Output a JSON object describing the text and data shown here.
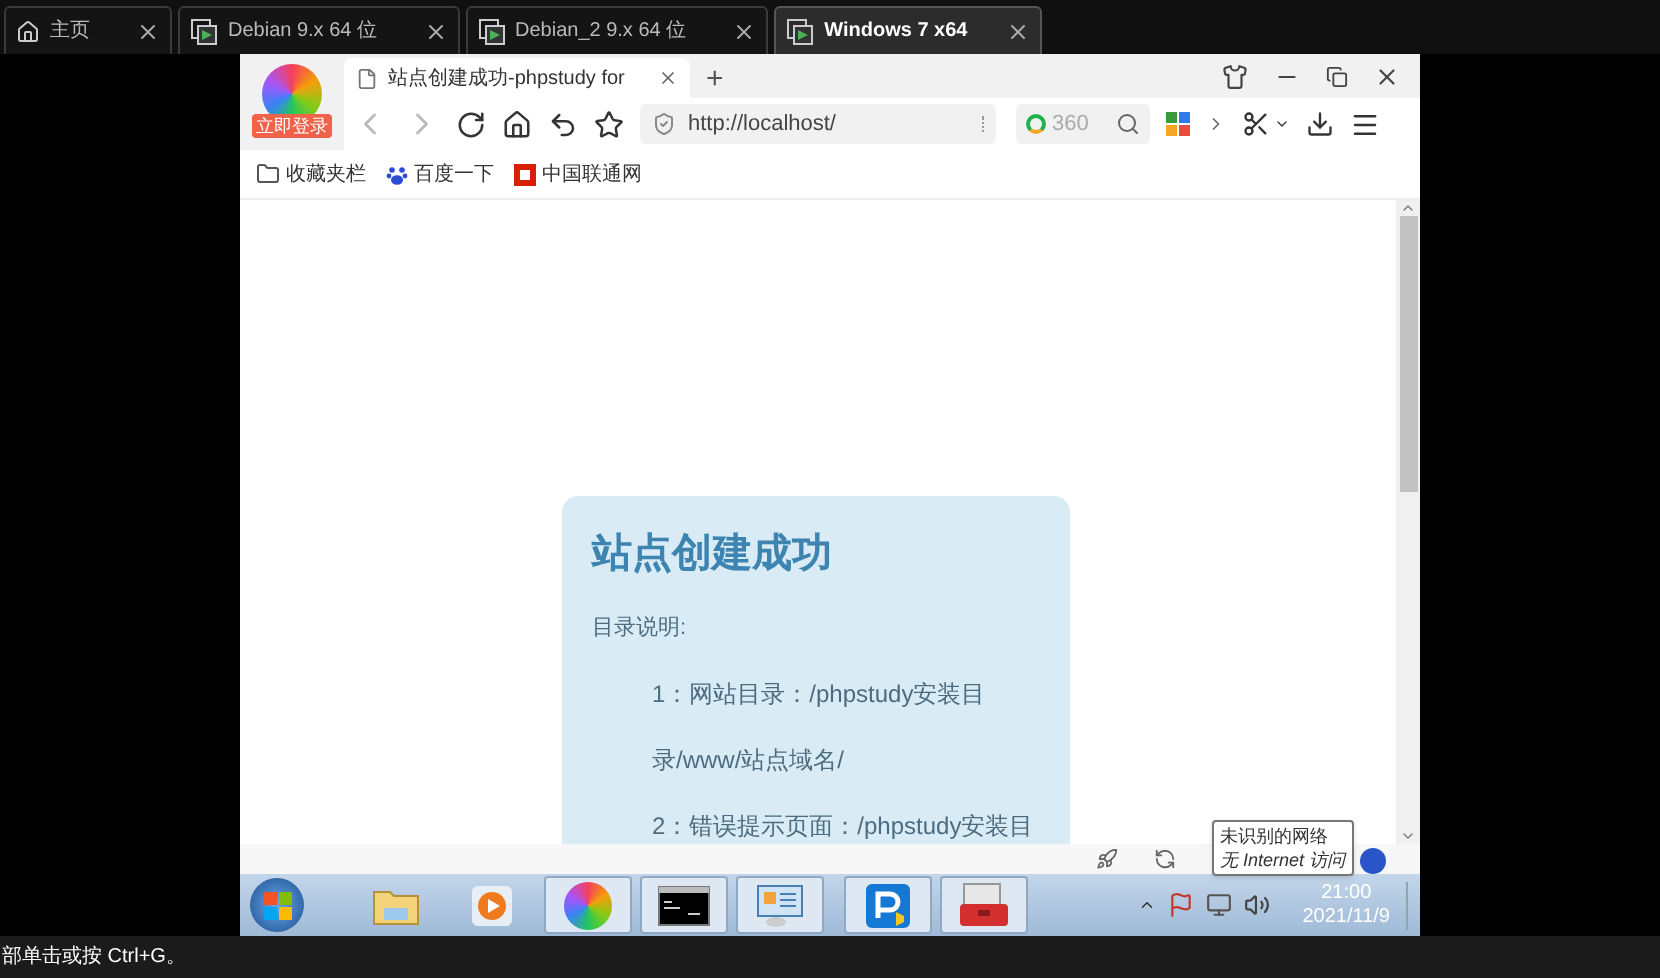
{
  "vm_tabs": [
    {
      "kind": "home",
      "label": "主页",
      "selected": false
    },
    {
      "kind": "vm",
      "label": "Debian 9.x 64 位",
      "selected": false
    },
    {
      "kind": "vm",
      "label": "Debian_2 9.x 64 位",
      "selected": false
    },
    {
      "kind": "vm",
      "label": "Windows 7 x64",
      "selected": true
    }
  ],
  "browser": {
    "login_badge": "立即登录",
    "tab_title": "站点创建成功-phpstudy for",
    "new_tab": "+",
    "address": "http://localhost/",
    "search_text": "360",
    "bookmarks": [
      "收藏夹栏",
      "百度一下",
      "中国联通网"
    ]
  },
  "page": {
    "title": "站点创建成功",
    "intro": "目录说明:",
    "lines": [
      "1：网站目录：/phpstudy安装目",
      "录/www/站点域名/",
      "2：错误提示页面：/phpstudy安装目"
    ]
  },
  "taskbar": {
    "apps": [
      {
        "kind": "explorer",
        "running": false
      },
      {
        "kind": "media",
        "running": false
      },
      {
        "kind": "browser360",
        "running": true
      },
      {
        "kind": "cmd",
        "running": true
      },
      {
        "kind": "control",
        "running": true
      },
      {
        "kind": "phpstudy",
        "running": true
      },
      {
        "kind": "toolbox",
        "running": true
      }
    ],
    "tooltip": [
      "未识别的网络",
      "无 Internet 访问"
    ],
    "time": "21:00",
    "date": "2021/11/9"
  },
  "status_bar": "部单击或按 Ctrl+G。"
}
